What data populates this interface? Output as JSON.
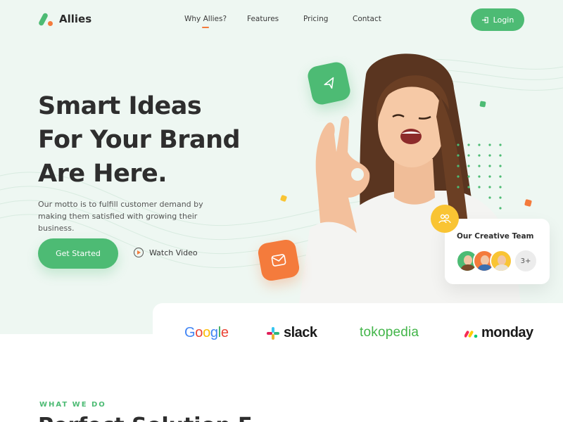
{
  "brand": {
    "name": "Allies"
  },
  "nav": {
    "items": [
      {
        "label": "Why Allies?",
        "active": true
      },
      {
        "label": "Features",
        "active": false
      },
      {
        "label": "Pricing",
        "active": false
      },
      {
        "label": "Contact",
        "active": false
      }
    ],
    "login_label": "Login"
  },
  "hero": {
    "headline": [
      "Smart Ideas",
      "For Your Brand",
      "Are Here."
    ],
    "motto": "Our motto is to fulfill customer demand by making them satisfied with growing their business.",
    "cta_label": "Get Started",
    "watch_label": "Watch Video"
  },
  "team_card": {
    "title": "Our Creative Team",
    "more_count": "3+"
  },
  "brands": {
    "google": "Google",
    "slack": "slack",
    "tokopedia": "tokopedia",
    "monday": "monday"
  },
  "section": {
    "eyebrow": "WHAT WE DO",
    "heading_partial": "Perfect Solution F"
  },
  "colors": {
    "accent_green": "#4dbb74",
    "accent_orange": "#f47b3c",
    "accent_yellow": "#f9c433",
    "hero_bg": "#eef7f2"
  },
  "icons": {
    "logo": "allies-logo-icon",
    "login": "login-icon",
    "play": "play-icon",
    "send": "paper-plane-icon",
    "mail": "mail-icon",
    "team": "team-icon",
    "slack": "slack-icon",
    "monday": "monday-icon"
  }
}
